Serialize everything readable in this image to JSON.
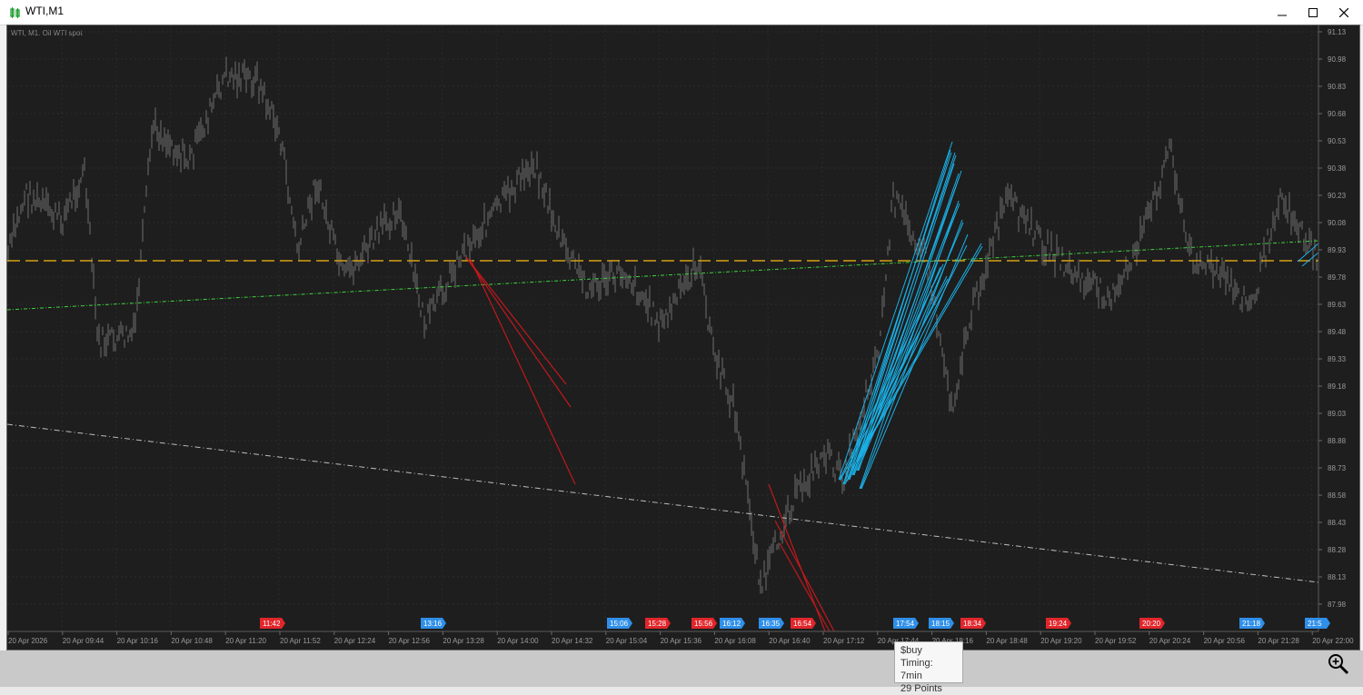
{
  "window": {
    "title": "WTI,M1",
    "controls": {
      "minimize": "minimize",
      "maximize": "maximize",
      "close": "close"
    }
  },
  "chart": {
    "header_label": "WTI, M1:  Oil WTI spot",
    "price_labels": [
      "91.13",
      "90.98",
      "90.83",
      "90.68",
      "90.53",
      "90.38",
      "90.23",
      "90.08",
      "89.93",
      "89.78",
      "89.63",
      "89.48",
      "89.33",
      "89.18",
      "89.03",
      "88.88",
      "88.73",
      "88.58",
      "88.43",
      "88.28",
      "88.13",
      "87.98"
    ],
    "time_labels": [
      "20 Apr 2026",
      "20 Apr 09:44",
      "20 Apr 10:16",
      "20 Apr 10:48",
      "20 Apr 11:20",
      "20 Apr 11:52",
      "20 Apr 12:24",
      "20 Apr 12:56",
      "20 Apr 13:28",
      "20 Apr 14:00",
      "20 Apr 14:32",
      "20 Apr 15:04",
      "20 Apr 15:36",
      "20 Apr 16:08",
      "20 Apr 16:40",
      "20 Apr 17:12",
      "20 Apr 17:44",
      "20 Apr 18:16",
      "20 Apr 18:48",
      "20 Apr 19:20",
      "20 Apr 19:52",
      "20 Apr 20:24",
      "20 Apr 20:56",
      "20 Apr 21:28",
      "20 Apr 22:00"
    ],
    "signal_tags": [
      {
        "label": "11:42",
        "color": "#e0262b"
      },
      {
        "label": "13:16",
        "color": "#2f8fe8"
      },
      {
        "label": "15:06",
        "color": "#2f8fe8"
      },
      {
        "label": "15:28",
        "color": "#e0262b"
      },
      {
        "label": "15:56",
        "color": "#e0262b"
      },
      {
        "label": "16:12",
        "color": "#2f8fe8"
      },
      {
        "label": "16:35",
        "color": "#2f8fe8"
      },
      {
        "label": "16:54",
        "color": "#e0262b"
      },
      {
        "label": "17:54",
        "color": "#2f8fe8"
      },
      {
        "label": "18:15",
        "color": "#2f8fe8"
      },
      {
        "label": "18:34",
        "color": "#e0262b"
      },
      {
        "label": "19:24",
        "color": "#e0262b"
      },
      {
        "label": "20:20",
        "color": "#e0262b"
      },
      {
        "label": "21:18",
        "color": "#2f8fe8"
      },
      {
        "label": "21:5",
        "color": "#2f8fe8"
      }
    ],
    "colors": {
      "background": "#1e1e1e",
      "candles": "#707070",
      "level_line": "#d4a017",
      "trend_green": "#3fd43f",
      "trend_grey": "#bdbdbd",
      "sell_lines": "#cc1a1a",
      "buy_lines": "#1ab0e6"
    }
  },
  "tooltip": {
    "line1": "$buy",
    "line2": "Timing: 7min",
    "line3": "29 Points"
  },
  "toolbar": {
    "zoom_icon": "magnifier-plus-icon"
  }
}
